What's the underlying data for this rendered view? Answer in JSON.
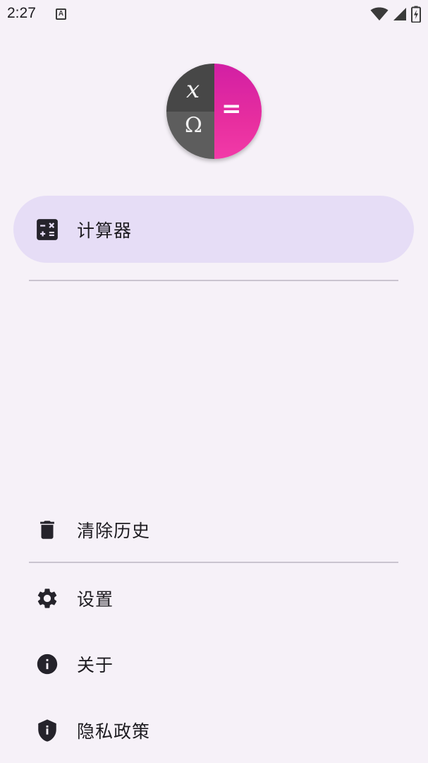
{
  "status_bar": {
    "time": "2:27",
    "notification_icon": "a-letter-icon",
    "icons": [
      "wifi-icon",
      "signal-icon",
      "battery-charging-icon"
    ]
  },
  "logo": {
    "symbols": {
      "top_left": "x",
      "bottom_left": "Ω",
      "right": "="
    },
    "colors": {
      "dark": "#474747",
      "mid": "#5d5d5d",
      "accent": "#e72e9f"
    }
  },
  "nav": {
    "primary": [
      {
        "label": "计算器",
        "icon": "calculator-icon",
        "active": true
      }
    ],
    "bottom": [
      {
        "label": "清除历史",
        "icon": "trash-icon"
      },
      {
        "label": "设置",
        "icon": "gear-icon"
      },
      {
        "label": "关于",
        "icon": "info-icon"
      },
      {
        "label": "隐私政策",
        "icon": "shield-icon"
      }
    ]
  },
  "colors": {
    "background": "#f6f1f8",
    "active_item": "#e6ddf6",
    "icon": "#25232b",
    "divider": "#cac4d0"
  }
}
